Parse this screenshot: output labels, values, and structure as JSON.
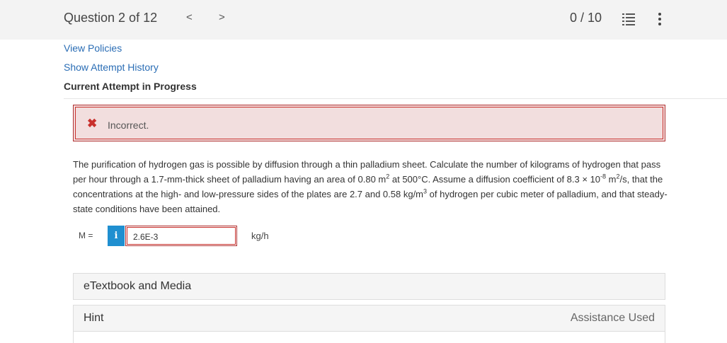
{
  "header": {
    "question_label": "Question 2 of 12",
    "prev_arrow": "<",
    "next_arrow": ">",
    "score": "0 / 10",
    "list_icon": "list-icon",
    "menu_icon": "kebab-menu-icon"
  },
  "links": {
    "view_policies": "View Policies",
    "show_attempt_history": "Show Attempt History"
  },
  "current_attempt": "Current Attempt in Progress",
  "alert": {
    "icon": "✖",
    "text": "Incorrect.",
    "background_color": "#f2dede",
    "border_color": "#c9302c"
  },
  "question": {
    "p1": "The purification of hydrogen gas is possible by diffusion through a thin palladium sheet. Calculate the number of kilograms of hydrogen that pass per hour through a 1.7-mm-thick sheet of palladium having an area of 0.80 m",
    "sup1": "2",
    "p2": " at 500°C. Assume a diffusion coefficient of 8.3 × 10",
    "sup2": "-8",
    "p3": " m",
    "sup3": "2",
    "p4": "/s, that the concentrations at the high- and low-pressure sides of the plates are 2.7 and 0.58 kg/m",
    "sup4": "3",
    "p5": " of hydrogen per cubic meter of palladium, and that steady-state conditions have been attained."
  },
  "answer": {
    "label": "M =",
    "info_icon": "i",
    "value": "2.6E-3",
    "unit": "kg/h"
  },
  "panels": {
    "etextbook": "eTextbook and Media",
    "hint": "Hint",
    "assistance_used": "Assistance Used"
  }
}
